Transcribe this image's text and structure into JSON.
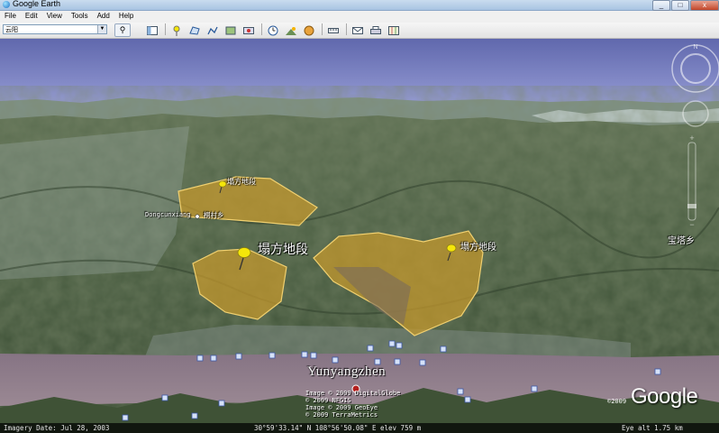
{
  "window": {
    "title": "Google Earth",
    "minimize": "_",
    "maximize": "□",
    "close": "x"
  },
  "menu": [
    "File",
    "Edit",
    "View",
    "Tools",
    "Add",
    "Help"
  ],
  "search": {
    "value": "云阳"
  },
  "toolbar": {
    "icons": [
      "sidebar-icon",
      "placemark-icon",
      "polygon-icon",
      "path-icon",
      "overlay-icon",
      "record-tour-icon",
      "historical-imagery-icon",
      "sunlight-icon",
      "switch-to-sky-icon",
      "ruler-icon",
      "email-icon",
      "print-icon",
      "view-in-maps-icon"
    ]
  },
  "map": {
    "placemarks": [
      {
        "label": "塌方地段"
      },
      {
        "label": "塌方地段"
      },
      {
        "label": "塌方地段"
      }
    ],
    "place_labels": {
      "dongcunxiang": "Dongcunxiang",
      "dongcunxiang_cn": "桐村乡",
      "baotaxiang": "宝塔乡",
      "yunyangzhen": "Yunyangzhen"
    },
    "credits": [
      "Image © 2009 DigitalGlobe",
      "© 2009 NFGIS",
      "Image © 2009 GeoEye",
      "© 2009 TerraMetrics"
    ],
    "logo": "Google",
    "logo_year": "©2009"
  },
  "status": {
    "imagery_date": "Imagery Date: Jul 28, 2003",
    "coordinates": "30°59'33.14\" N   108°56'50.08\" E  elev  759 m",
    "eye_alt": "Eye alt    1.75 km"
  },
  "colors": {
    "polygon_fill": "#c89a2c",
    "polygon_stroke": "#f0d070",
    "pin": "#f5e60a",
    "sky_top": "#6f76b8",
    "river": "#8d7a86"
  }
}
